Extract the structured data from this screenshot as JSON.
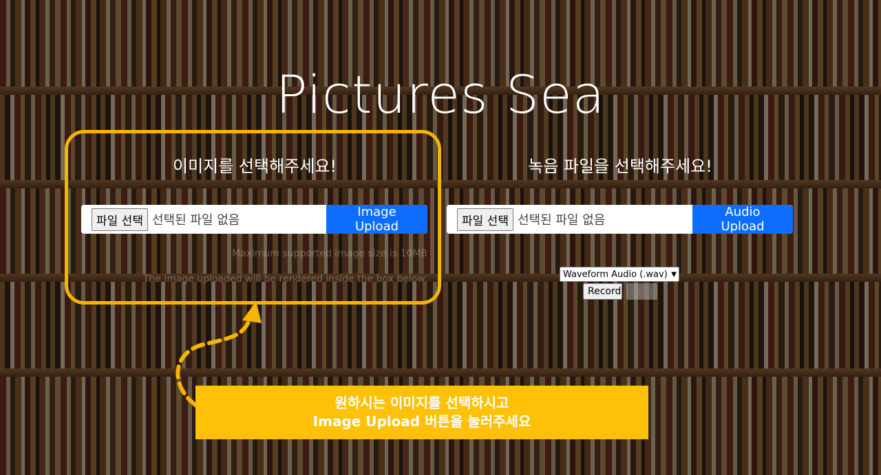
{
  "page": {
    "title": "Pictures Sea"
  },
  "image_section": {
    "heading": "이미지를 선택해주세요!",
    "choose_file_label": "파일 선택",
    "no_file_text": "선택된 파일 없음",
    "upload_label": "Image Upload",
    "hint_max_size": "Maximum supported image size is 10MB",
    "hint_render": "The image uploaded will be rendered inside the box below."
  },
  "audio_section": {
    "heading": "녹음 파일을 선택해주세요!",
    "choose_file_label": "파일 선택",
    "no_file_text": "선택된 파일 없음",
    "upload_label": "Audio Upload",
    "format_selected": "Waveform Audio (.wav)",
    "record_label": "Record",
    "stop_label": "Stop"
  },
  "tutorial": {
    "line1": "원하시는 이미지를 선택하시고",
    "line2": "Image Upload 버튼을 눌러주세요"
  },
  "colors": {
    "accent": "#f4b400",
    "primary": "#0d6efd",
    "callout": "#ffc107"
  },
  "icons": {
    "select_chevron": "chevron-down-icon"
  }
}
